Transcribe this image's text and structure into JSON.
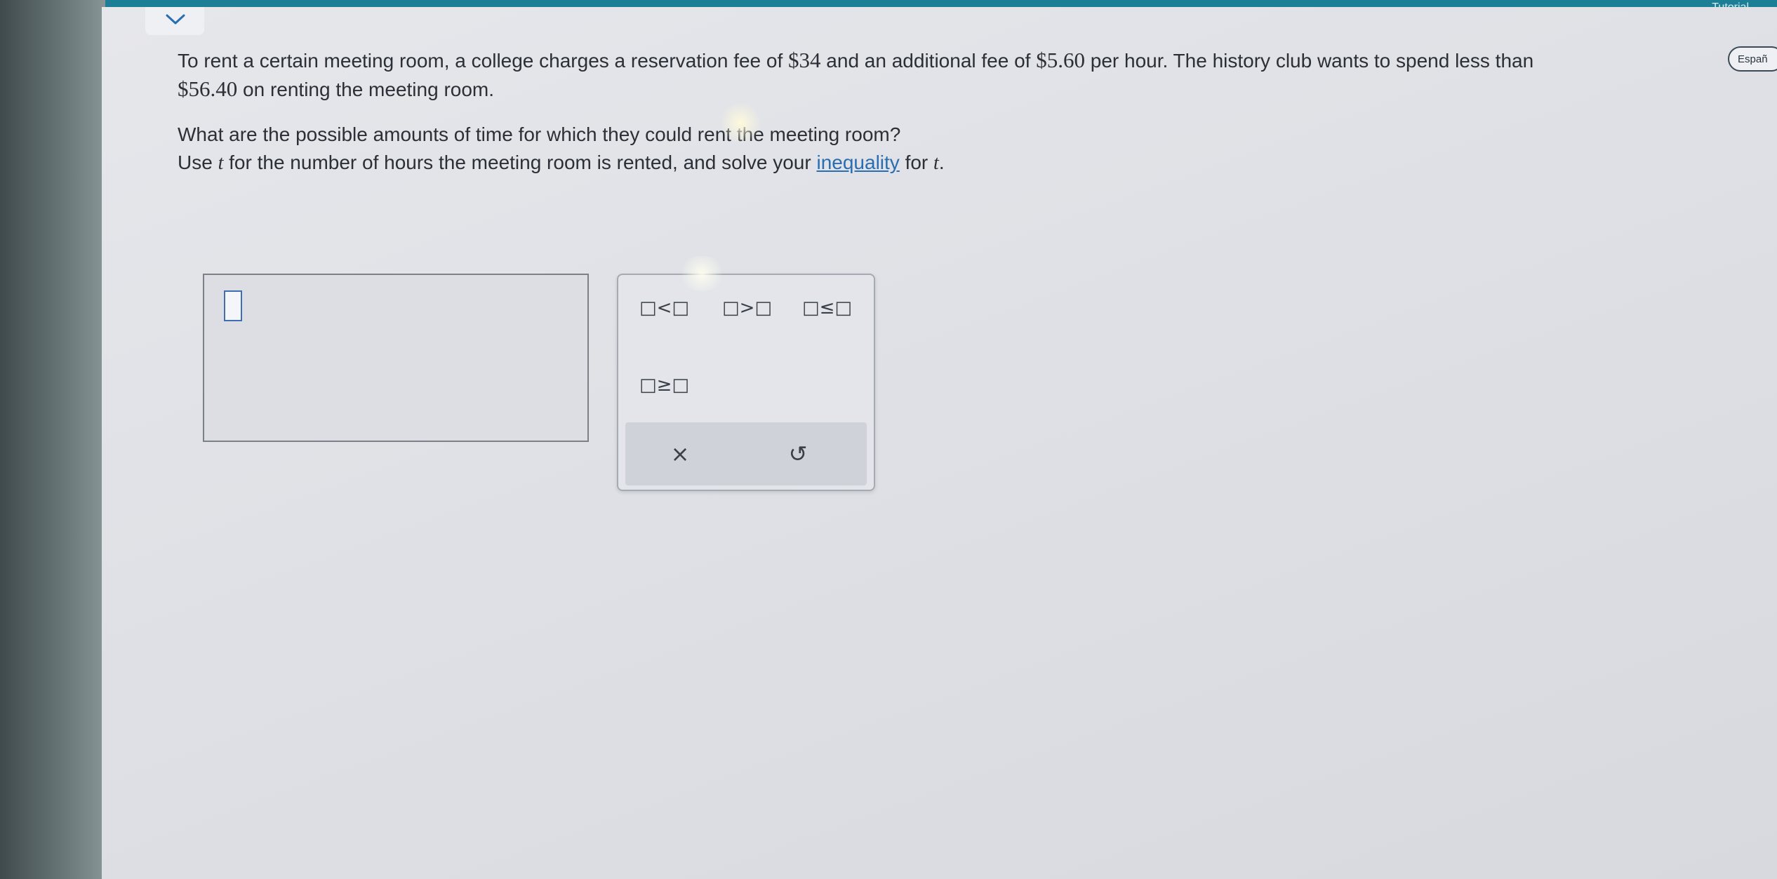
{
  "topbar": {
    "right_text": "Tutorial"
  },
  "language_button": {
    "label": "Españ"
  },
  "problem": {
    "sentence1_a": "To rent a certain meeting room, a college charges a reservation fee of ",
    "fee_reservation": "$34",
    "sentence1_b": " and an additional fee of ",
    "fee_hourly": "$5.60",
    "sentence1_c": " per hour. The history club wants to spend less than",
    "budget": "$56.40",
    "sentence1_d": " on renting the meeting room.",
    "question": "What are the possible amounts of time for which they could rent the meeting room?",
    "instruction_a": "Use ",
    "variable": "t",
    "instruction_b": " for the number of hours the meeting room is rented, and solve your ",
    "instruction_link": "inequality",
    "instruction_c": " for ",
    "variable2": "t",
    "instruction_d": "."
  },
  "palette": {
    "less_than": "□<□",
    "greater_than": "□>□",
    "less_equal": "□≤□",
    "greater_equal": "□≥□",
    "clear": "×",
    "undo": "↺"
  },
  "colors": {
    "topbar": "#1d7f95",
    "link": "#2a6db0",
    "cursor_box": "#3f6fb0"
  }
}
